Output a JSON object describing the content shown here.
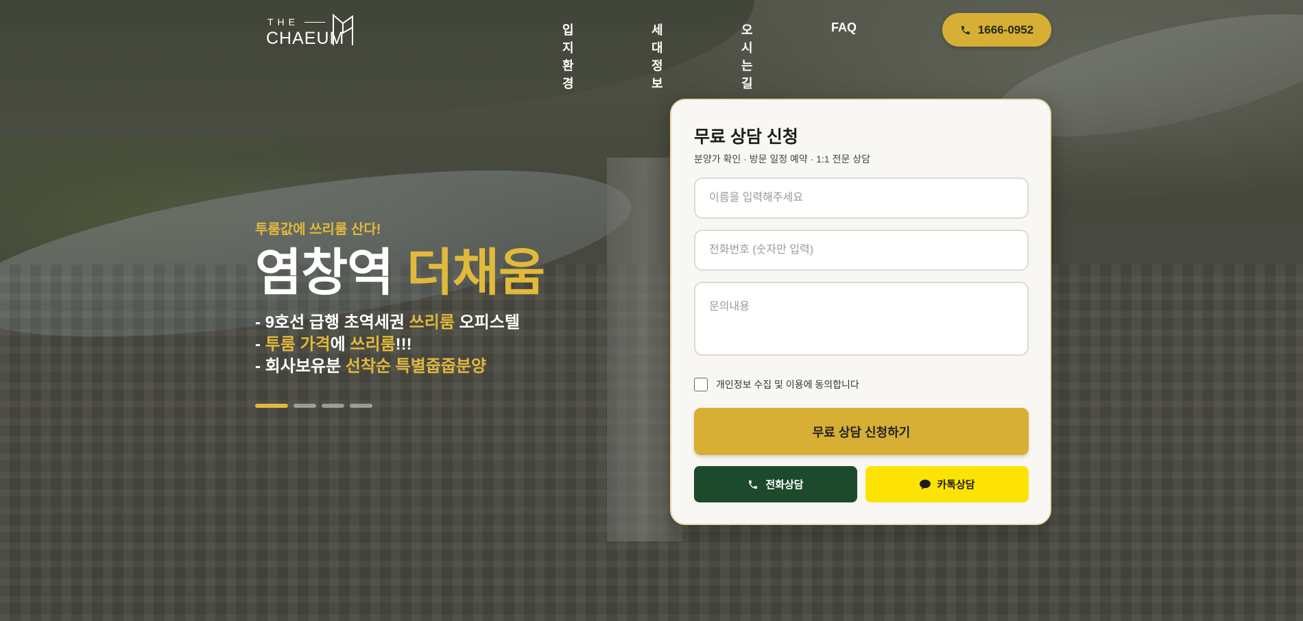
{
  "brand": {
    "logo_small": "THE",
    "logo_main": "CHAEUM"
  },
  "nav": {
    "items": [
      "입지환경",
      "세대정보",
      "오시는길",
      "FAQ"
    ]
  },
  "header": {
    "phone": "1666-0952",
    "phone_icon": "phone-icon"
  },
  "hero": {
    "tagline": "투룸값에 쓰리룸 산다!",
    "title_main": "염창역",
    "title_accent": "더채움",
    "bullets": [
      {
        "prefix": "- 9호선 급행 초역세권 ",
        "hl": "쓰리룸",
        "suffix": " 오피스텔"
      },
      {
        "prefix": "- ",
        "hl": "투룸 가격",
        "mid": "에 ",
        "hl2": "쓰리룸",
        "suffix": "!!!"
      },
      {
        "prefix": "- 회사보유분 ",
        "hl": "선착순 특별줍줍분양",
        "suffix": ""
      }
    ],
    "slides_total": 4,
    "slide_active": 1
  },
  "form": {
    "title": "무료 상담 신청",
    "subtitle": "분양가 확인 · 방문 일정 예약 · 1:1 전문 상담",
    "name_placeholder": "이름을 입력해주세요",
    "phone_placeholder": "전화번호 (숫자만 입력)",
    "message_placeholder": "문의내용",
    "agree_label": "개인정보 수집 및 이용에 동의합니다",
    "agree_checked": false,
    "submit_label": "무료 상담 신청하기",
    "phone_consult_label": "전화상담",
    "kakao_consult_label": "카톡상담"
  },
  "colors": {
    "accent": "#d6af34",
    "dark_green": "#1d4a2c",
    "kakao_yellow": "#fde304"
  }
}
